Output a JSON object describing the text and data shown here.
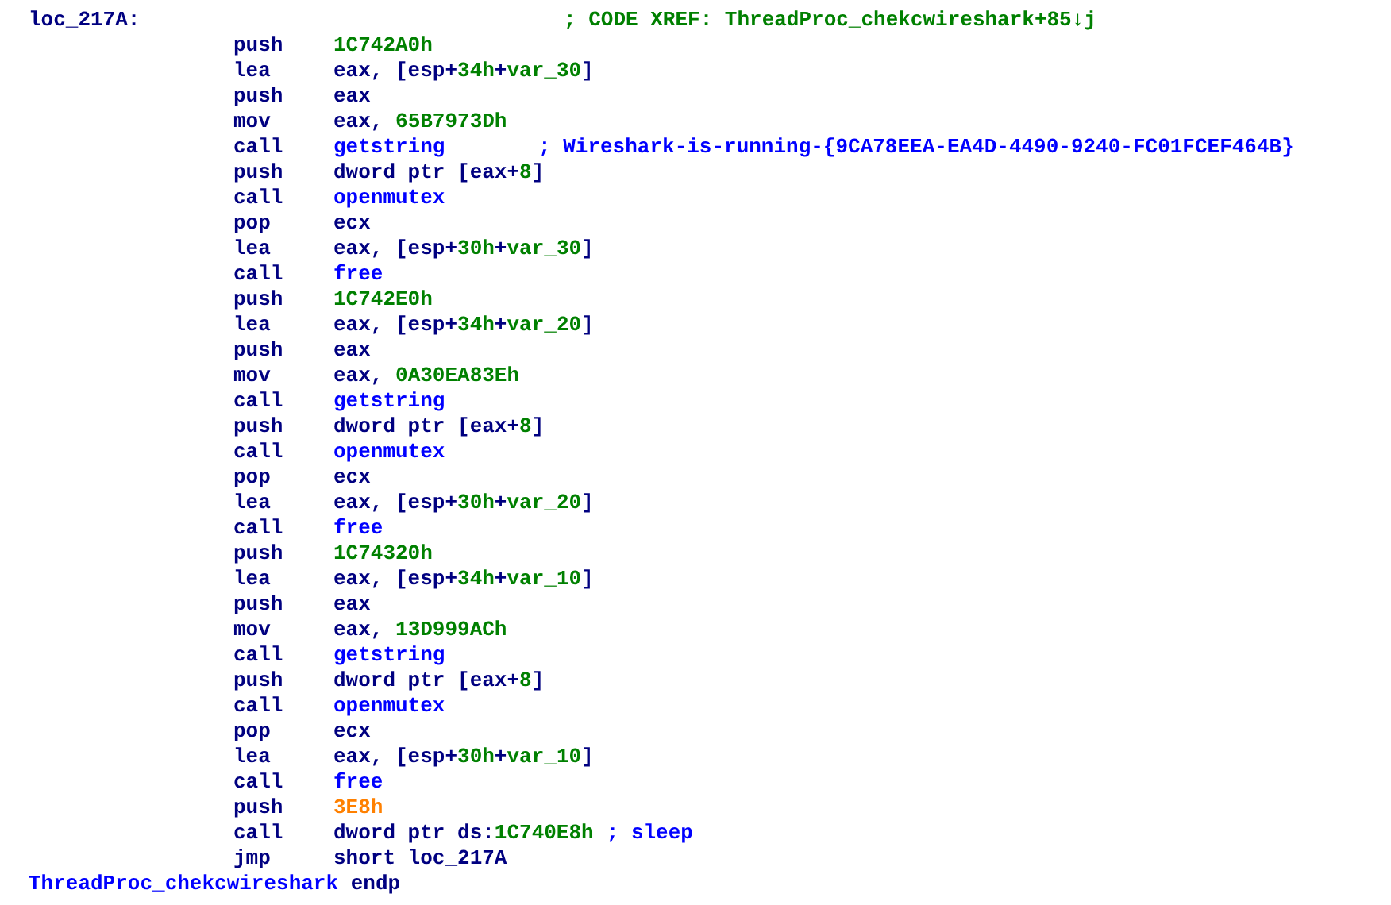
{
  "listing": [
    {
      "kind": "label",
      "label": "loc_217A:",
      "comment": [
        {
          "text": "; CODE XREF: ThreadProc_chekcwireshark+85↓j",
          "kind": "num"
        }
      ]
    },
    {
      "kind": "instr",
      "mnemonic": "push",
      "operand": [
        {
          "text": "1C742A0h",
          "kind": "num"
        }
      ]
    },
    {
      "kind": "instr",
      "mnemonic": "lea",
      "operand": [
        {
          "text": "eax, [esp+",
          "kind": "reg"
        },
        {
          "text": "34h",
          "kind": "num"
        },
        {
          "text": "+",
          "kind": "reg"
        },
        {
          "text": "var_30",
          "kind": "num"
        },
        {
          "text": "]",
          "kind": "reg"
        }
      ]
    },
    {
      "kind": "instr",
      "mnemonic": "push",
      "operand": [
        {
          "text": "eax",
          "kind": "reg"
        }
      ]
    },
    {
      "kind": "instr",
      "mnemonic": "mov",
      "operand": [
        {
          "text": "eax, ",
          "kind": "reg"
        },
        {
          "text": "65B7973Dh",
          "kind": "num"
        }
      ]
    },
    {
      "kind": "instr",
      "mnemonic": "call",
      "operand": [
        {
          "text": "getstring",
          "kind": "name"
        }
      ],
      "comment": [
        {
          "text": "; Wireshark-is-running-{9CA78EEA-EA4D-4490-9240-FC01FCEF464B}",
          "kind": "name"
        }
      ]
    },
    {
      "kind": "instr",
      "mnemonic": "push",
      "operand": [
        {
          "text": "dword ptr [eax+",
          "kind": "reg"
        },
        {
          "text": "8",
          "kind": "num"
        },
        {
          "text": "]",
          "kind": "reg"
        }
      ]
    },
    {
      "kind": "instr",
      "mnemonic": "call",
      "operand": [
        {
          "text": "openmutex",
          "kind": "name"
        }
      ]
    },
    {
      "kind": "instr",
      "mnemonic": "pop",
      "operand": [
        {
          "text": "ecx",
          "kind": "reg"
        }
      ]
    },
    {
      "kind": "instr",
      "mnemonic": "lea",
      "operand": [
        {
          "text": "eax, [esp+",
          "kind": "reg"
        },
        {
          "text": "30h",
          "kind": "num"
        },
        {
          "text": "+",
          "kind": "reg"
        },
        {
          "text": "var_30",
          "kind": "num"
        },
        {
          "text": "]",
          "kind": "reg"
        }
      ]
    },
    {
      "kind": "instr",
      "mnemonic": "call",
      "operand": [
        {
          "text": "free",
          "kind": "name"
        }
      ]
    },
    {
      "kind": "instr",
      "mnemonic": "push",
      "operand": [
        {
          "text": "1C742E0h",
          "kind": "num"
        }
      ]
    },
    {
      "kind": "instr",
      "mnemonic": "lea",
      "operand": [
        {
          "text": "eax, [esp+",
          "kind": "reg"
        },
        {
          "text": "34h",
          "kind": "num"
        },
        {
          "text": "+",
          "kind": "reg"
        },
        {
          "text": "var_20",
          "kind": "num"
        },
        {
          "text": "]",
          "kind": "reg"
        }
      ]
    },
    {
      "kind": "instr",
      "mnemonic": "push",
      "operand": [
        {
          "text": "eax",
          "kind": "reg"
        }
      ]
    },
    {
      "kind": "instr",
      "mnemonic": "mov",
      "operand": [
        {
          "text": "eax, ",
          "kind": "reg"
        },
        {
          "text": "0A30EA83Eh",
          "kind": "num"
        }
      ]
    },
    {
      "kind": "instr",
      "mnemonic": "call",
      "operand": [
        {
          "text": "getstring",
          "kind": "name"
        }
      ]
    },
    {
      "kind": "instr",
      "mnemonic": "push",
      "operand": [
        {
          "text": "dword ptr [eax+",
          "kind": "reg"
        },
        {
          "text": "8",
          "kind": "num"
        },
        {
          "text": "]",
          "kind": "reg"
        }
      ]
    },
    {
      "kind": "instr",
      "mnemonic": "call",
      "operand": [
        {
          "text": "openmutex",
          "kind": "name"
        }
      ]
    },
    {
      "kind": "instr",
      "mnemonic": "pop",
      "operand": [
        {
          "text": "ecx",
          "kind": "reg"
        }
      ]
    },
    {
      "kind": "instr",
      "mnemonic": "lea",
      "operand": [
        {
          "text": "eax, [esp+",
          "kind": "reg"
        },
        {
          "text": "30h",
          "kind": "num"
        },
        {
          "text": "+",
          "kind": "reg"
        },
        {
          "text": "var_20",
          "kind": "num"
        },
        {
          "text": "]",
          "kind": "reg"
        }
      ]
    },
    {
      "kind": "instr",
      "mnemonic": "call",
      "operand": [
        {
          "text": "free",
          "kind": "name"
        }
      ]
    },
    {
      "kind": "instr",
      "mnemonic": "push",
      "operand": [
        {
          "text": "1C74320h",
          "kind": "num"
        }
      ]
    },
    {
      "kind": "instr",
      "mnemonic": "lea",
      "operand": [
        {
          "text": "eax, [esp+",
          "kind": "reg"
        },
        {
          "text": "34h",
          "kind": "num"
        },
        {
          "text": "+",
          "kind": "reg"
        },
        {
          "text": "var_10",
          "kind": "num"
        },
        {
          "text": "]",
          "kind": "reg"
        }
      ]
    },
    {
      "kind": "instr",
      "mnemonic": "push",
      "operand": [
        {
          "text": "eax",
          "kind": "reg"
        }
      ]
    },
    {
      "kind": "instr",
      "mnemonic": "mov",
      "operand": [
        {
          "text": "eax, ",
          "kind": "reg"
        },
        {
          "text": "13D999ACh",
          "kind": "num"
        }
      ]
    },
    {
      "kind": "instr",
      "mnemonic": "call",
      "operand": [
        {
          "text": "getstring",
          "kind": "name"
        }
      ]
    },
    {
      "kind": "instr",
      "mnemonic": "push",
      "operand": [
        {
          "text": "dword ptr [eax+",
          "kind": "reg"
        },
        {
          "text": "8",
          "kind": "num"
        },
        {
          "text": "]",
          "kind": "reg"
        }
      ]
    },
    {
      "kind": "instr",
      "mnemonic": "call",
      "operand": [
        {
          "text": "openmutex",
          "kind": "name"
        }
      ]
    },
    {
      "kind": "instr",
      "mnemonic": "pop",
      "operand": [
        {
          "text": "ecx",
          "kind": "reg"
        }
      ]
    },
    {
      "kind": "instr",
      "mnemonic": "lea",
      "operand": [
        {
          "text": "eax, [esp+",
          "kind": "reg"
        },
        {
          "text": "30h",
          "kind": "num"
        },
        {
          "text": "+",
          "kind": "reg"
        },
        {
          "text": "var_10",
          "kind": "num"
        },
        {
          "text": "]",
          "kind": "reg"
        }
      ]
    },
    {
      "kind": "instr",
      "mnemonic": "call",
      "operand": [
        {
          "text": "free",
          "kind": "name"
        }
      ]
    },
    {
      "kind": "instr",
      "mnemonic": "push",
      "operand": [
        {
          "text": "3E8h",
          "kind": "const"
        }
      ]
    },
    {
      "kind": "instr",
      "mnemonic": "call",
      "operand": [
        {
          "text": "dword ptr ds:",
          "kind": "reg"
        },
        {
          "text": "1C740E8h",
          "kind": "num"
        }
      ],
      "comment": [
        {
          "text": "; sleep",
          "kind": "name"
        }
      ]
    },
    {
      "kind": "instr",
      "mnemonic": "jmp",
      "operand": [
        {
          "text": "short loc_217A",
          "kind": "reg"
        }
      ]
    },
    {
      "kind": "endp",
      "label": [
        {
          "text": "ThreadProc_chekcwireshark",
          "kind": "name"
        },
        {
          "text": " endp",
          "kind": "reg"
        }
      ]
    }
  ]
}
